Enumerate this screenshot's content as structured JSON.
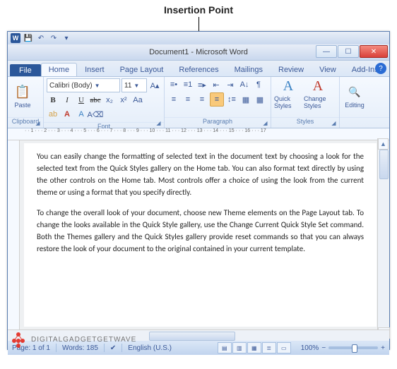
{
  "caption": "Insertion Point",
  "qat": {
    "word_letter": "W"
  },
  "titlebar": {
    "title": "Document1  -  Microsoft Word"
  },
  "tabs": {
    "file": "File",
    "items": [
      "Home",
      "Insert",
      "Page Layout",
      "References",
      "Mailings",
      "Review",
      "View",
      "Add-Ins"
    ],
    "active": 0
  },
  "ribbon": {
    "clipboard": {
      "label": "Clipboard",
      "paste": "Paste"
    },
    "font": {
      "label": "Font",
      "family": "Calibri (Body)",
      "size": "11"
    },
    "paragraph": {
      "label": "Paragraph"
    },
    "styles": {
      "label": "Styles",
      "quick": "Quick Styles",
      "change": "Change Styles"
    },
    "editing": {
      "label": "Editing"
    }
  },
  "document": {
    "para1": "You can easily change the formatting of selected text in the document text by choosing a look for the selected text from the Quick Styles gallery on the Home tab. You can also format text directly by using the other controls on the Home tab. Most controls offer a choice of using the look from the current theme or using a format that you specify directly.",
    "para2": "To change the overall look of your document, choose new Theme elements on the Page Layout tab. To change the looks available in the Quick Style gallery, use the Change Current Quick Style Set command. Both the Themes gallery and the Quick Styles gallery provide reset commands so that you can always restore the look of your document to the original contained in your current template."
  },
  "statusbar": {
    "page": "Page: 1 of 1",
    "words": "Words: 185",
    "lang": "English (U.S.)",
    "zoom": "100%"
  },
  "watermark": {
    "text": "DIGITALGADGETGETWAVE"
  }
}
